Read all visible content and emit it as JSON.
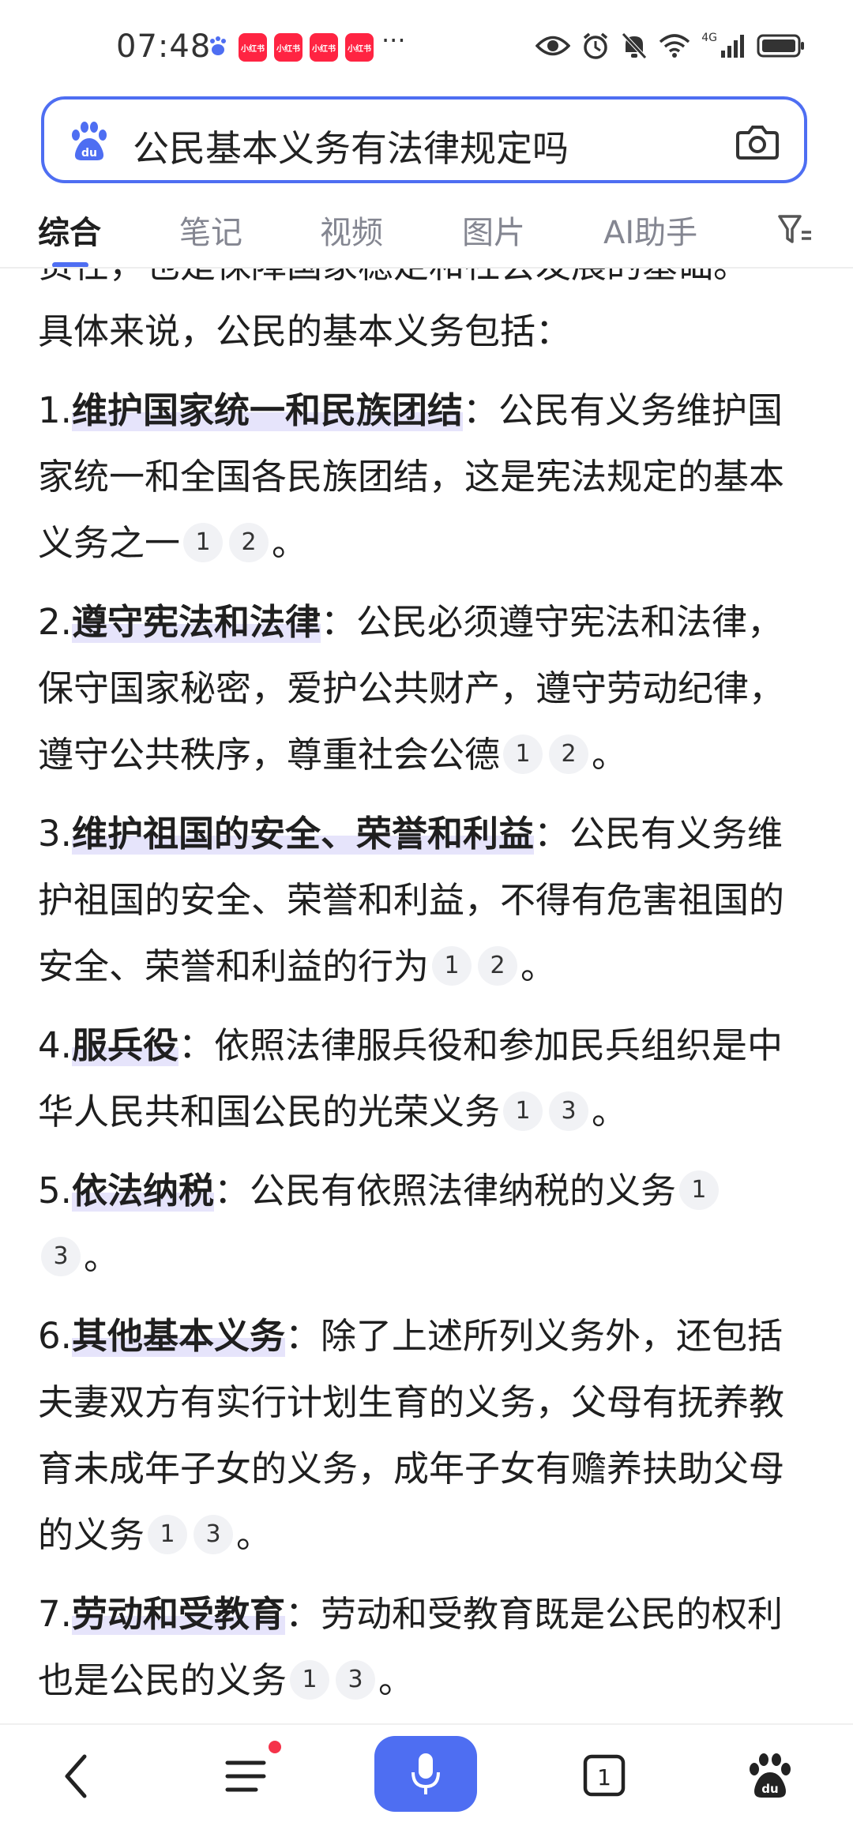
{
  "status_bar": {
    "time": "07:48",
    "notification_apps": [
      "小红书",
      "小红书",
      "小红书",
      "小红书"
    ],
    "more": "···",
    "network": "4G",
    "icons": [
      "eye-icon",
      "alarm-icon",
      "mute-icon",
      "wifi-icon",
      "signal-icon",
      "battery-icon"
    ]
  },
  "search": {
    "query": "公民基本义务有法律规定吗",
    "brand_icon": "baidu-paw-icon",
    "camera_icon": "camera-icon"
  },
  "tabs": [
    {
      "label": "综合",
      "active": true
    },
    {
      "label": "笔记",
      "active": false
    },
    {
      "label": "视频",
      "active": false
    },
    {
      "label": "图片",
      "active": false
    },
    {
      "label": "AI助手",
      "active": false
    }
  ],
  "content": {
    "partial_top": "责任，也是保障国家稳定和社会发展的基础。",
    "intro": "具体来说，公民的基本义务包括：",
    "items": [
      {
        "num": "1.",
        "title": "维护国家统一和民族团结",
        "text": "：公民有义务维护国家统一和全国各民族团结，这是宪法规定的基本义务之一",
        "refs": [
          "1",
          "2"
        ],
        "end": "。"
      },
      {
        "num": "2.",
        "title": "遵守宪法和法律",
        "text": "：公民必须遵守宪法和法律，保守国家秘密，爱护公共财产，遵守劳动纪律，遵守公共秩序，尊重社会公德",
        "refs": [
          "1",
          "2"
        ],
        "end": "。"
      },
      {
        "num": "3.",
        "title": "维护祖国的安全、荣誉和利益",
        "text": "：公民有义务维护祖国的安全、荣誉和利益，不得有危害祖国的安全、荣誉和利益的行为",
        "refs": [
          "1",
          "2"
        ],
        "end": "。"
      },
      {
        "num": "4.",
        "title": "服兵役",
        "text": "：依照法律服兵役和参加民兵组织是中华人民共和国公民的光荣义务",
        "refs": [
          "1",
          "3"
        ],
        "end": "。"
      },
      {
        "num": "5.",
        "title": "依法纳税",
        "text": "：公民有依照法律纳税的义务",
        "refs": [
          "1",
          "3"
        ],
        "end": "。"
      },
      {
        "num": "6.",
        "title": "其他基本义务",
        "text": "：除了上述所列义务外，还包括夫妻双方有实行计划生育的义务，父母有抚养教育未成年子女的义务，成年子女有赡养扶助父母的义务",
        "refs": [
          "1",
          "3"
        ],
        "end": "。"
      },
      {
        "num": "7.",
        "title": "劳动和受教育",
        "text": "：劳动和受教育既是公民的权利也是公民的义务",
        "refs": [
          "1",
          "3"
        ],
        "end": "。"
      }
    ]
  },
  "bottom_nav": {
    "tab_count": "1",
    "has_badge": true
  },
  "colors": {
    "accent": "#4e6ef2",
    "highlight": "#e6e4fb",
    "badge": "#f5334a",
    "xiaohongshu": "#ff2442"
  }
}
